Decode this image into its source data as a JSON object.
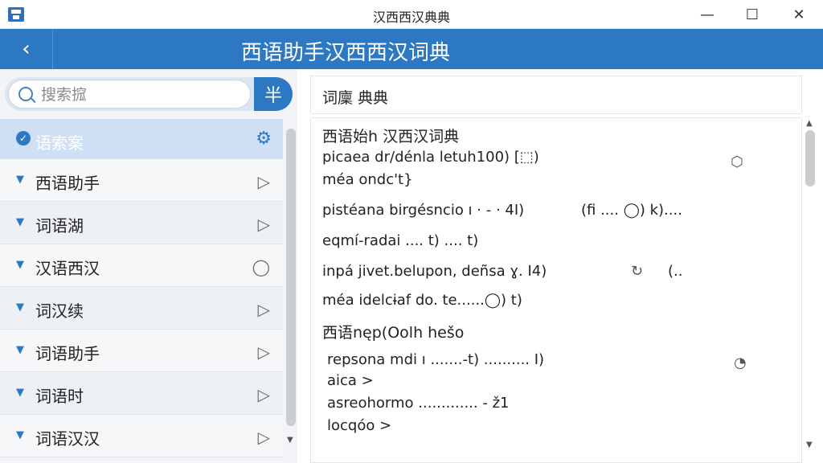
{
  "window": {
    "title": "汉西西汉典典",
    "minimize": "—",
    "maximize": "☐",
    "close": "✕"
  },
  "header": {
    "back": "‹",
    "title": "西语助手汉西西汉词典"
  },
  "search": {
    "placeholder": "搜索搲",
    "button_label": "半"
  },
  "sidebar": {
    "items": [
      {
        "label": "语索案",
        "state": "active"
      },
      {
        "label": "西语助手"
      },
      {
        "label": "词语湖"
      },
      {
        "label": "汉语西汉"
      },
      {
        "label": "词汉续"
      },
      {
        "label": "词语助手"
      },
      {
        "label": "词语时"
      },
      {
        "label": "词语汉汉"
      }
    ]
  },
  "panel": {
    "header": "词廩 典典",
    "lines": [
      {
        "text": "西语始h 汉西汉词典"
      },
      {
        "text": "picaea dr/dénla letuh100) [⬚)"
      },
      {
        "text": "méa ondc't}"
      },
      {
        "text": "pistéana birgésncio ı · - · 4I)"
      },
      {
        "text": "(ﬁ ....  ◯)  k)...."
      },
      {
        "text": "eqmí-radai ....  t) ....  t)"
      },
      {
        "text": "inpá jivet.belupon, deñsa ɣ. I4)"
      },
      {
        "text": "(.."
      },
      {
        "text": "méa idelcɨaf do. te......◯) t)"
      },
      {
        "text": "西语nęp(Oolh hešo"
      },
      {
        "text": "repsona mdi ı .......-t) ..........  I)"
      },
      {
        "text": "aica >"
      },
      {
        "text": "asreohormo  .............  -  ž1"
      },
      {
        "text": "locqóo >"
      }
    ]
  }
}
